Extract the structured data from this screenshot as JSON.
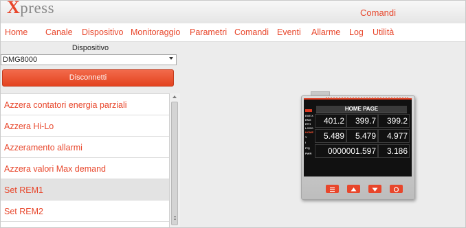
{
  "app": {
    "logo_letter": "X",
    "logo_rest": "press",
    "section_title": "Comandi",
    "accent": "#e8462b"
  },
  "nav": [
    {
      "label": "Home"
    },
    {
      "label": "Canale"
    },
    {
      "label": "Dispositivo"
    },
    {
      "label": "Monitoraggio"
    },
    {
      "label": "Parametri"
    },
    {
      "label": "Comandi"
    },
    {
      "label": "Eventi"
    },
    {
      "label": "Allarme"
    },
    {
      "label": "Log"
    },
    {
      "label": "Utilità"
    }
  ],
  "device_panel": {
    "label": "Dispositivo",
    "selected": "DMG8000",
    "disconnect_label": "Disconnetti"
  },
  "commands": [
    {
      "label": "Azzera contatori energia parziali",
      "selected": false
    },
    {
      "label": "Azzera Hi-Lo",
      "selected": false
    },
    {
      "label": "Azzeramento allarmi",
      "selected": false
    },
    {
      "label": "Azzera valori Max demand",
      "selected": false
    },
    {
      "label": "Set REM1",
      "selected": true
    },
    {
      "label": "Set REM2",
      "selected": false
    }
  ],
  "meter": {
    "screen_title": "HOME PAGE",
    "row1": [
      "401.2",
      "399.7",
      "399.2"
    ],
    "row2": [
      "5.489",
      "5.479",
      "4.977"
    ],
    "row3": [
      "0000001.597",
      "3.186"
    ],
    "side_labels": [
      "EXE X",
      "ENG",
      "ETH",
      "LOGO",
      "HOME",
      "V",
      "I",
      "P/Q",
      "PWR"
    ]
  }
}
